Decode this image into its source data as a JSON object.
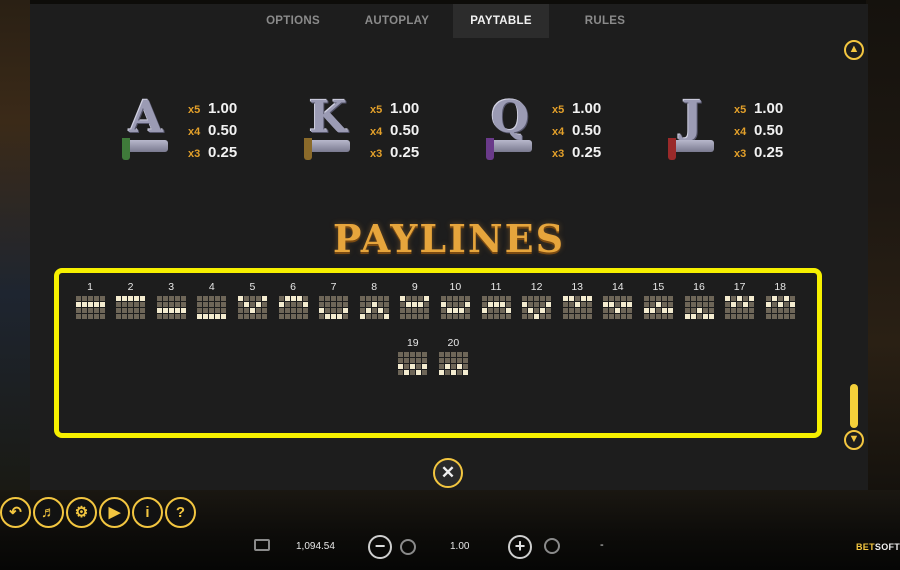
{
  "tabs": [
    {
      "label": "OPTIONS",
      "active": false
    },
    {
      "label": "AUTOPLAY",
      "active": false
    },
    {
      "label": "PAYTABLE",
      "active": true
    },
    {
      "label": "RULES",
      "active": false
    }
  ],
  "symbols": [
    {
      "letter": "A",
      "tassel": "#3f7a3a",
      "pays": [
        {
          "mult": "x5",
          "value": "1.00"
        },
        {
          "mult": "x4",
          "value": "0.50"
        },
        {
          "mult": "x3",
          "value": "0.25"
        }
      ]
    },
    {
      "letter": "K",
      "tassel": "#8a6a2a",
      "pays": [
        {
          "mult": "x5",
          "value": "1.00"
        },
        {
          "mult": "x4",
          "value": "0.50"
        },
        {
          "mult": "x3",
          "value": "0.25"
        }
      ]
    },
    {
      "letter": "Q",
      "tassel": "#6a3a8a",
      "pays": [
        {
          "mult": "x5",
          "value": "1.00"
        },
        {
          "mult": "x4",
          "value": "0.50"
        },
        {
          "mult": "x3",
          "value": "0.25"
        }
      ]
    },
    {
      "letter": "J",
      "tassel": "#9a2a2a",
      "pays": [
        {
          "mult": "x5",
          "value": "1.00"
        },
        {
          "mult": "x4",
          "value": "0.50"
        },
        {
          "mult": "x3",
          "value": "0.25"
        }
      ]
    }
  ],
  "paylines_title": "PAYLINES",
  "paylines": [
    {
      "num": "1",
      "rows": [
        1,
        1,
        1,
        1,
        1
      ]
    },
    {
      "num": "2",
      "rows": [
        0,
        0,
        0,
        0,
        0
      ]
    },
    {
      "num": "3",
      "rows": [
        2,
        2,
        2,
        2,
        2
      ]
    },
    {
      "num": "4",
      "rows": [
        3,
        3,
        3,
        3,
        3
      ]
    },
    {
      "num": "5",
      "rows": [
        0,
        1,
        2,
        1,
        0
      ]
    },
    {
      "num": "6",
      "rows": [
        1,
        0,
        0,
        0,
        1
      ]
    },
    {
      "num": "7",
      "rows": [
        2,
        3,
        3,
        3,
        2
      ]
    },
    {
      "num": "8",
      "rows": [
        3,
        2,
        1,
        2,
        3
      ]
    },
    {
      "num": "9",
      "rows": [
        0,
        1,
        1,
        1,
        0
      ]
    },
    {
      "num": "10",
      "rows": [
        1,
        2,
        2,
        2,
        1
      ]
    },
    {
      "num": "11",
      "rows": [
        2,
        1,
        1,
        1,
        2
      ]
    },
    {
      "num": "12",
      "rows": [
        1,
        2,
        3,
        2,
        1
      ]
    },
    {
      "num": "13",
      "rows": [
        0,
        0,
        1,
        0,
        0
      ]
    },
    {
      "num": "14",
      "rows": [
        1,
        1,
        2,
        1,
        1
      ]
    },
    {
      "num": "15",
      "rows": [
        2,
        2,
        1,
        2,
        2
      ]
    },
    {
      "num": "16",
      "rows": [
        3,
        3,
        2,
        3,
        3
      ]
    },
    {
      "num": "17",
      "rows": [
        0,
        1,
        0,
        1,
        0
      ]
    },
    {
      "num": "18",
      "rows": [
        1,
        0,
        1,
        0,
        1
      ]
    },
    {
      "num": "19",
      "rows": [
        2,
        3,
        2,
        3,
        2
      ]
    },
    {
      "num": "20",
      "rows": [
        3,
        2,
        3,
        2,
        3
      ]
    }
  ],
  "controls": {
    "back_icon": "back-arrow-icon",
    "sound_icon": "speaker-icon",
    "settings_icon": "gear-icon",
    "autoplay_icon": "autoplay-icon",
    "info_icon": "info-icon",
    "help_icon": "question-icon"
  },
  "bottom": {
    "balance": "1,094.54",
    "bet": "1.00",
    "win": "-",
    "logo_prefix": "BET",
    "logo_suffix": "SOFT"
  },
  "colors": {
    "accent": "#f3c640",
    "highlight_box": "#f6f000",
    "multiplier": "#e3a02a",
    "payline_cell_off": "#6e6658",
    "payline_cell_on": "#f4ecd0"
  }
}
